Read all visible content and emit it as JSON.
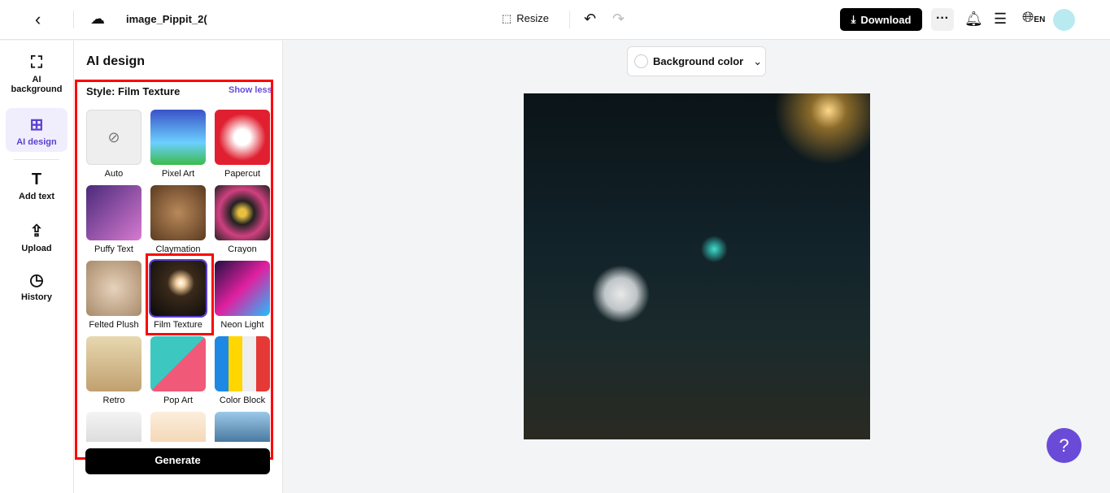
{
  "header": {
    "filename": "image_Pippit_2(",
    "resize": "Resize",
    "download": "Download",
    "lang": "EN"
  },
  "rail": [
    {
      "label": "AI background",
      "icon": "bag-icon"
    },
    {
      "label": "AI design",
      "icon": "ai-design-icon",
      "active": true
    },
    {
      "label": "Add text",
      "icon": "text-icon"
    },
    {
      "label": "Upload",
      "icon": "upload-icon"
    },
    {
      "label": "History",
      "icon": "history-icon"
    }
  ],
  "panel": {
    "title": "AI design",
    "style_label": "Style: Film Texture",
    "show_less": "Show less",
    "generate": "Generate",
    "styles": [
      {
        "label": "Auto"
      },
      {
        "label": "Pixel Art"
      },
      {
        "label": "Papercut"
      },
      {
        "label": "Puffy Text"
      },
      {
        "label": "Claymation"
      },
      {
        "label": "Crayon"
      },
      {
        "label": "Felted Plush"
      },
      {
        "label": "Film Texture",
        "selected": true
      },
      {
        "label": "Neon Light"
      },
      {
        "label": "Retro"
      },
      {
        "label": "Pop Art"
      },
      {
        "label": "Color Block"
      },
      {
        "label": ""
      },
      {
        "label": ""
      },
      {
        "label": ""
      }
    ]
  },
  "canvas": {
    "background_color": "Background color"
  },
  "colors": {
    "accent": "#6a4bd8",
    "highlight": "#ff0000"
  }
}
